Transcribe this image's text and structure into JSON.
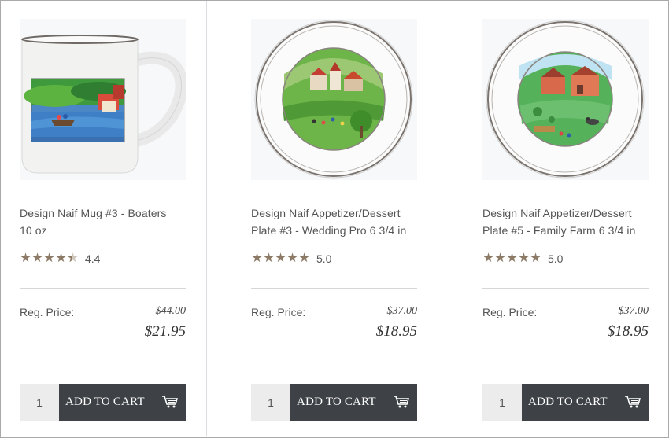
{
  "products": [
    {
      "name": "Design Naif Mug #3 - Boaters 10 oz",
      "rating_value": "4.4",
      "rating_stars": 4.4,
      "reg_label": "Reg. Price:",
      "old_price": "$44.00",
      "price": "$21.95",
      "qty": "1",
      "cart_label": "ADD TO CART",
      "image_icon": "mug-image"
    },
    {
      "name": "Design Naif Appetizer/Dessert Plate #3 - Wedding Pro 6 3/4 in",
      "rating_value": "5.0",
      "rating_stars": 5.0,
      "reg_label": "Reg. Price:",
      "old_price": "$37.00",
      "price": "$18.95",
      "qty": "1",
      "cart_label": "ADD TO CART",
      "image_icon": "plate-image"
    },
    {
      "name": "Design Naif Appetizer/Dessert Plate #5 - Family Farm 6 3/4 in",
      "rating_value": "5.0",
      "rating_stars": 5.0,
      "reg_label": "Reg. Price:",
      "old_price": "$37.00",
      "price": "$18.95",
      "qty": "1",
      "cart_label": "ADD TO CART",
      "image_icon": "plate-image"
    }
  ],
  "colors": {
    "button_bg": "#3e4145",
    "star": "#8c7a67",
    "qty_bg": "#ececec"
  },
  "icons": {
    "cart": "shopping-cart-icon",
    "star": "star-icon"
  }
}
